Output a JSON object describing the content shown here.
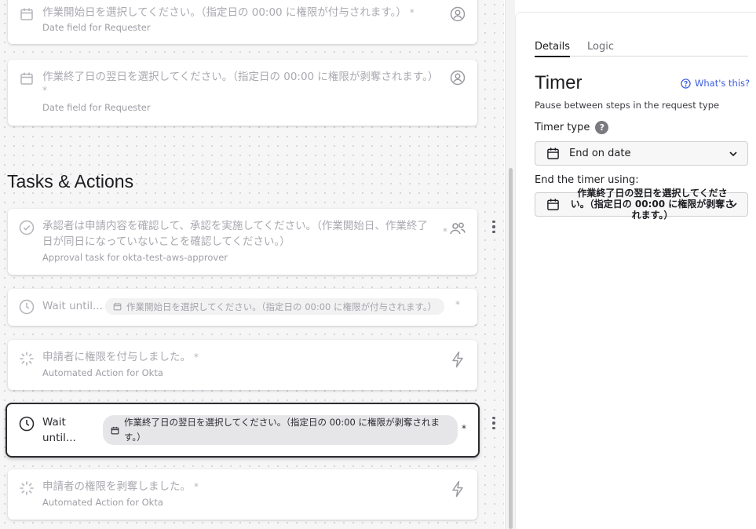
{
  "canvas": {
    "date_cards": [
      {
        "title": "作業開始日を選択してください。（指定日の 00:00 に権限が付与されます。）",
        "required": "*",
        "subtitle": "Date field for Requester"
      },
      {
        "title": "作業終了日の翌日を選択してください。（指定日の 00:00 に権限が剥奪されます。）",
        "required": "*",
        "subtitle": "Date field for Requester"
      }
    ],
    "section_title": "Tasks & Actions",
    "approval_task": {
      "title": "承認者は申請内容を確認して、承認を実施してください。（作業開始日、作業終了日が同日になっていないことを確認してください。）",
      "required": "*",
      "subtitle": "Approval task for okta-test-aws-approver"
    },
    "wait_1": {
      "label": "Wait until...",
      "chip": "作業開始日を選択してください。（指定日の 00:00 に権限が付与されます。）",
      "required": "*"
    },
    "action_1": {
      "title": "申請者に権限を付与しました。",
      "required": "*",
      "subtitle": "Automated Action for Okta"
    },
    "wait_2": {
      "label": "Wait until...",
      "chip": "作業終了日の翌日を選択してください。（指定日の 00:00 に権限が剥奪されます。）",
      "required": "*"
    },
    "action_2": {
      "title": "申請者の権限を剥奪しました。",
      "required": "*",
      "subtitle": "Automated Action for Okta"
    }
  },
  "panel": {
    "tabs": [
      {
        "label": "Details",
        "active": true
      },
      {
        "label": "Logic",
        "active": false
      }
    ],
    "title": "Timer",
    "whats_this": "What's this?",
    "description": "Pause between steps in the request type",
    "timer_type_label": "Timer type",
    "timer_type_value": "End on date",
    "end_label": "End the timer using:",
    "end_value": "作業終了日の翌日を選択してください。（指定日の 00:00 に権限が剥奪されます。）"
  },
  "colors": {
    "accent_link": "#3b5bdb",
    "selected_border": "#2b2b30",
    "canvas_bg": "#f6f6f7"
  }
}
